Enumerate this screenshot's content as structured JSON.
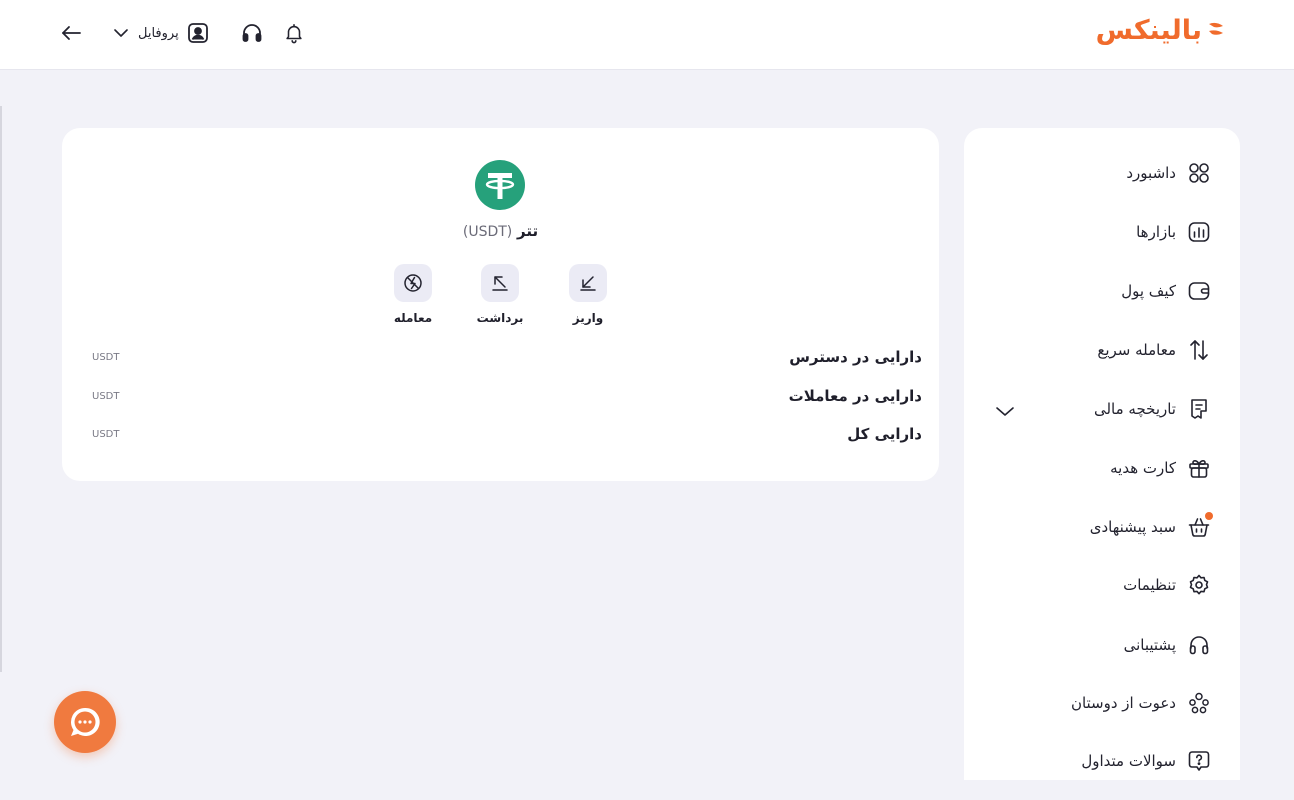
{
  "header": {
    "logo_text": "بالینکس",
    "profile_label": "پروفایل",
    "icons": [
      "back-arrow-icon",
      "chevron-down-icon",
      "user-icon",
      "headset-icon",
      "bell-icon"
    ]
  },
  "sidebar": {
    "items": [
      {
        "label": "داشبورد",
        "icon": "dashboard-grid-icon"
      },
      {
        "label": "بازارها",
        "icon": "market-chart-icon"
      },
      {
        "label": "کیف پول",
        "icon": "wallet-icon"
      },
      {
        "label": "معامله سریع",
        "icon": "swap-arrows-icon"
      },
      {
        "label": "تاریخچه مالی",
        "icon": "receipt-icon"
      },
      {
        "label": "کارت هدیه",
        "icon": "gift-icon"
      },
      {
        "label": "سبد پیشنهادی",
        "icon": "basket-icon"
      },
      {
        "label": "تنظیمات",
        "icon": "settings-gear-icon"
      },
      {
        "label": "پشتیبانی",
        "icon": "headset-icon"
      },
      {
        "label": "دعوت از دوستان",
        "icon": "users-invite-icon"
      },
      {
        "label": "سوالات متداول",
        "icon": "faq-question-icon"
      }
    ]
  },
  "asset": {
    "name": "تتر",
    "symbol": "(USDT)",
    "actions": [
      {
        "label": "واریز",
        "icon": "deposit-arrow-icon"
      },
      {
        "label": "برداشت",
        "icon": "withdraw-arrow-icon"
      },
      {
        "label": "معامله",
        "icon": "trade-icon"
      }
    ],
    "balances": [
      {
        "label": "دارایی در دسترس",
        "unit": "USDT"
      },
      {
        "label": "دارایی در معاملات",
        "unit": "USDT"
      },
      {
        "label": "دارایی کل",
        "unit": "USDT"
      }
    ]
  },
  "colors": {
    "brand": "#f06b2c",
    "tether": "#26a17b",
    "page_bg": "#f2f2f8",
    "notification_dot": "#f06b2c"
  }
}
